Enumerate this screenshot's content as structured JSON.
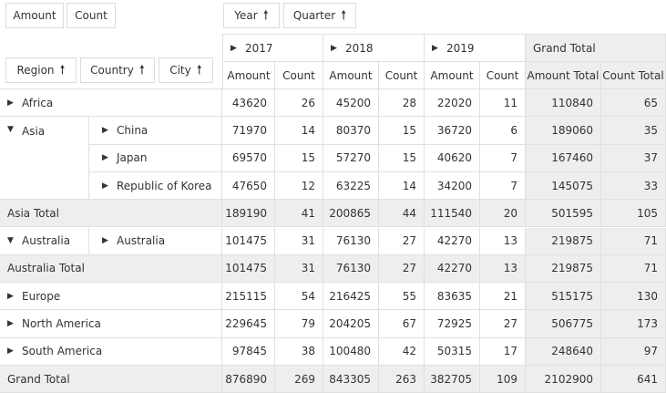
{
  "filter_fields": [
    "Amount",
    "Count"
  ],
  "column_fields": [
    "Year",
    "Quarter"
  ],
  "row_fields": [
    "Region",
    "Country",
    "City"
  ],
  "sort_glyph": "🠕",
  "years": [
    "2017",
    "2018",
    "2019"
  ],
  "grand_total_label": "Grand Total",
  "measure_labels": {
    "amount": "Amount",
    "count": "Count",
    "amount_total": "Amount Total",
    "count_total": "Count Total"
  },
  "rows": [
    {
      "region": "Africa",
      "country": "",
      "expand": "collapsed",
      "values": [
        "43620",
        "26",
        "45200",
        "28",
        "22020",
        "11",
        "110840",
        "65"
      ]
    },
    {
      "region": "Asia",
      "country": "China",
      "expand": "expanded",
      "values": [
        "71970",
        "14",
        "80370",
        "15",
        "36720",
        "6",
        "189060",
        "35"
      ]
    },
    {
      "region": "",
      "country": "Japan",
      "expand": "",
      "values": [
        "69570",
        "15",
        "57270",
        "15",
        "40620",
        "7",
        "167460",
        "37"
      ]
    },
    {
      "region": "",
      "country": "Republic of Korea",
      "expand": "",
      "values": [
        "47650",
        "12",
        "63225",
        "14",
        "34200",
        "7",
        "145075",
        "33"
      ]
    },
    {
      "total": "Asia Total",
      "values": [
        "189190",
        "41",
        "200865",
        "44",
        "111540",
        "20",
        "501595",
        "105"
      ]
    },
    {
      "region": "Australia",
      "country": "Australia",
      "expand": "expanded",
      "values": [
        "101475",
        "31",
        "76130",
        "27",
        "42270",
        "13",
        "219875",
        "71"
      ]
    },
    {
      "total": "Australia Total",
      "values": [
        "101475",
        "31",
        "76130",
        "27",
        "42270",
        "13",
        "219875",
        "71"
      ]
    },
    {
      "region": "Europe",
      "country": "",
      "expand": "collapsed",
      "values": [
        "215115",
        "54",
        "216425",
        "55",
        "83635",
        "21",
        "515175",
        "130"
      ]
    },
    {
      "region": "North America",
      "country": "",
      "expand": "collapsed",
      "values": [
        "229645",
        "79",
        "204205",
        "67",
        "72925",
        "27",
        "506775",
        "173"
      ]
    },
    {
      "region": "South America",
      "country": "",
      "expand": "collapsed",
      "values": [
        "97845",
        "38",
        "100480",
        "42",
        "50315",
        "17",
        "248640",
        "97"
      ]
    },
    {
      "total": "Grand Total",
      "values": [
        "876890",
        "269",
        "843305",
        "263",
        "382705",
        "109",
        "2102900",
        "641"
      ]
    }
  ]
}
